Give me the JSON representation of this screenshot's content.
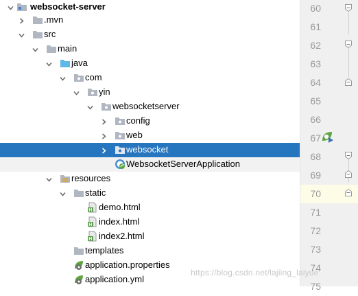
{
  "tree": {
    "rows": [
      {
        "label": "websocket-server",
        "icon": "module-folder-icon",
        "arrow": "down"
      },
      {
        "label": ".mvn",
        "icon": "folder-icon",
        "arrow": "right"
      },
      {
        "label": "src",
        "icon": "folder-icon",
        "arrow": "down"
      },
      {
        "label": "main",
        "icon": "folder-icon",
        "arrow": "down"
      },
      {
        "label": "java",
        "icon": "source-root-folder-icon",
        "arrow": "down"
      },
      {
        "label": "com",
        "icon": "package-icon",
        "arrow": "down"
      },
      {
        "label": "yin",
        "icon": "package-icon",
        "arrow": "down"
      },
      {
        "label": "websocketserver",
        "icon": "package-icon",
        "arrow": "down"
      },
      {
        "label": "config",
        "icon": "package-icon",
        "arrow": "right"
      },
      {
        "label": "web",
        "icon": "package-icon",
        "arrow": "right"
      },
      {
        "label": "websocket",
        "icon": "package-icon",
        "arrow": "right"
      },
      {
        "label": "WebsocketServerApplication",
        "icon": "spring-boot-class-icon",
        "arrow": "none"
      },
      {
        "label": "resources",
        "icon": "resources-folder-icon",
        "arrow": "down"
      },
      {
        "label": "static",
        "icon": "folder-icon",
        "arrow": "down"
      },
      {
        "label": "demo.html",
        "icon": "html-file-icon",
        "arrow": "none"
      },
      {
        "label": "index.html",
        "icon": "html-file-icon",
        "arrow": "none"
      },
      {
        "label": "index2.html",
        "icon": "html-file-icon",
        "arrow": "none"
      },
      {
        "label": "templates",
        "icon": "folder-icon",
        "arrow": "none"
      },
      {
        "label": "application.properties",
        "icon": "spring-config-file-icon",
        "arrow": "none"
      },
      {
        "label": "application.yml",
        "icon": "spring-config-file-icon",
        "arrow": "none"
      }
    ]
  },
  "gutter": {
    "line_numbers": [
      "60",
      "61",
      "62",
      "63",
      "64",
      "65",
      "66",
      "67",
      "68",
      "69",
      "70",
      "71",
      "72",
      "73",
      "74",
      "75"
    ],
    "current_line": "70",
    "run_icon": "spring-run-gutter-icon"
  },
  "watermark": "https://blog.csdn.net/lajiing_laiyue",
  "colors": {
    "selection": "#2675bf",
    "folder": "#b0b7c1",
    "source_root": "#5fb8e5",
    "spring_green": "#5ea441",
    "current_line": "#fdfce7"
  }
}
